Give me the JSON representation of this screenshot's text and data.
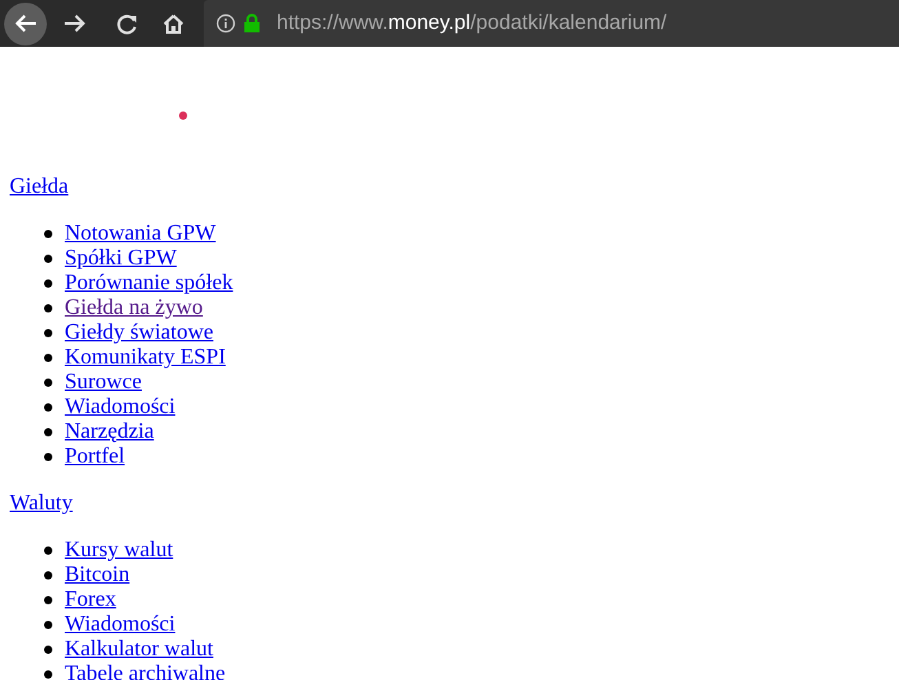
{
  "address_bar": {
    "url_prefix": "https://www.",
    "url_domain": "money.pl",
    "url_path": "/podatki/kalendarium/"
  },
  "sections": [
    {
      "heading": "Giełda",
      "items": [
        {
          "label": "Notowania GPW",
          "visited": false
        },
        {
          "label": "Spółki GPW",
          "visited": false
        },
        {
          "label": "Porównanie spółek",
          "visited": false
        },
        {
          "label": "Giełda na żywo",
          "visited": true
        },
        {
          "label": "Giełdy światowe",
          "visited": false
        },
        {
          "label": "Komunikaty ESPI",
          "visited": false
        },
        {
          "label": "Surowce",
          "visited": false
        },
        {
          "label": "Wiadomości",
          "visited": false
        },
        {
          "label": "Narzędzia",
          "visited": false
        },
        {
          "label": "Portfel",
          "visited": false
        }
      ]
    },
    {
      "heading": "Waluty",
      "items": [
        {
          "label": "Kursy walut",
          "visited": false
        },
        {
          "label": "Bitcoin",
          "visited": false
        },
        {
          "label": "Forex",
          "visited": false
        },
        {
          "label": "Wiadomości",
          "visited": false
        },
        {
          "label": "Kalkulator walut",
          "visited": false
        },
        {
          "label": "Tabele archiwalne",
          "visited": false
        }
      ]
    }
  ]
}
